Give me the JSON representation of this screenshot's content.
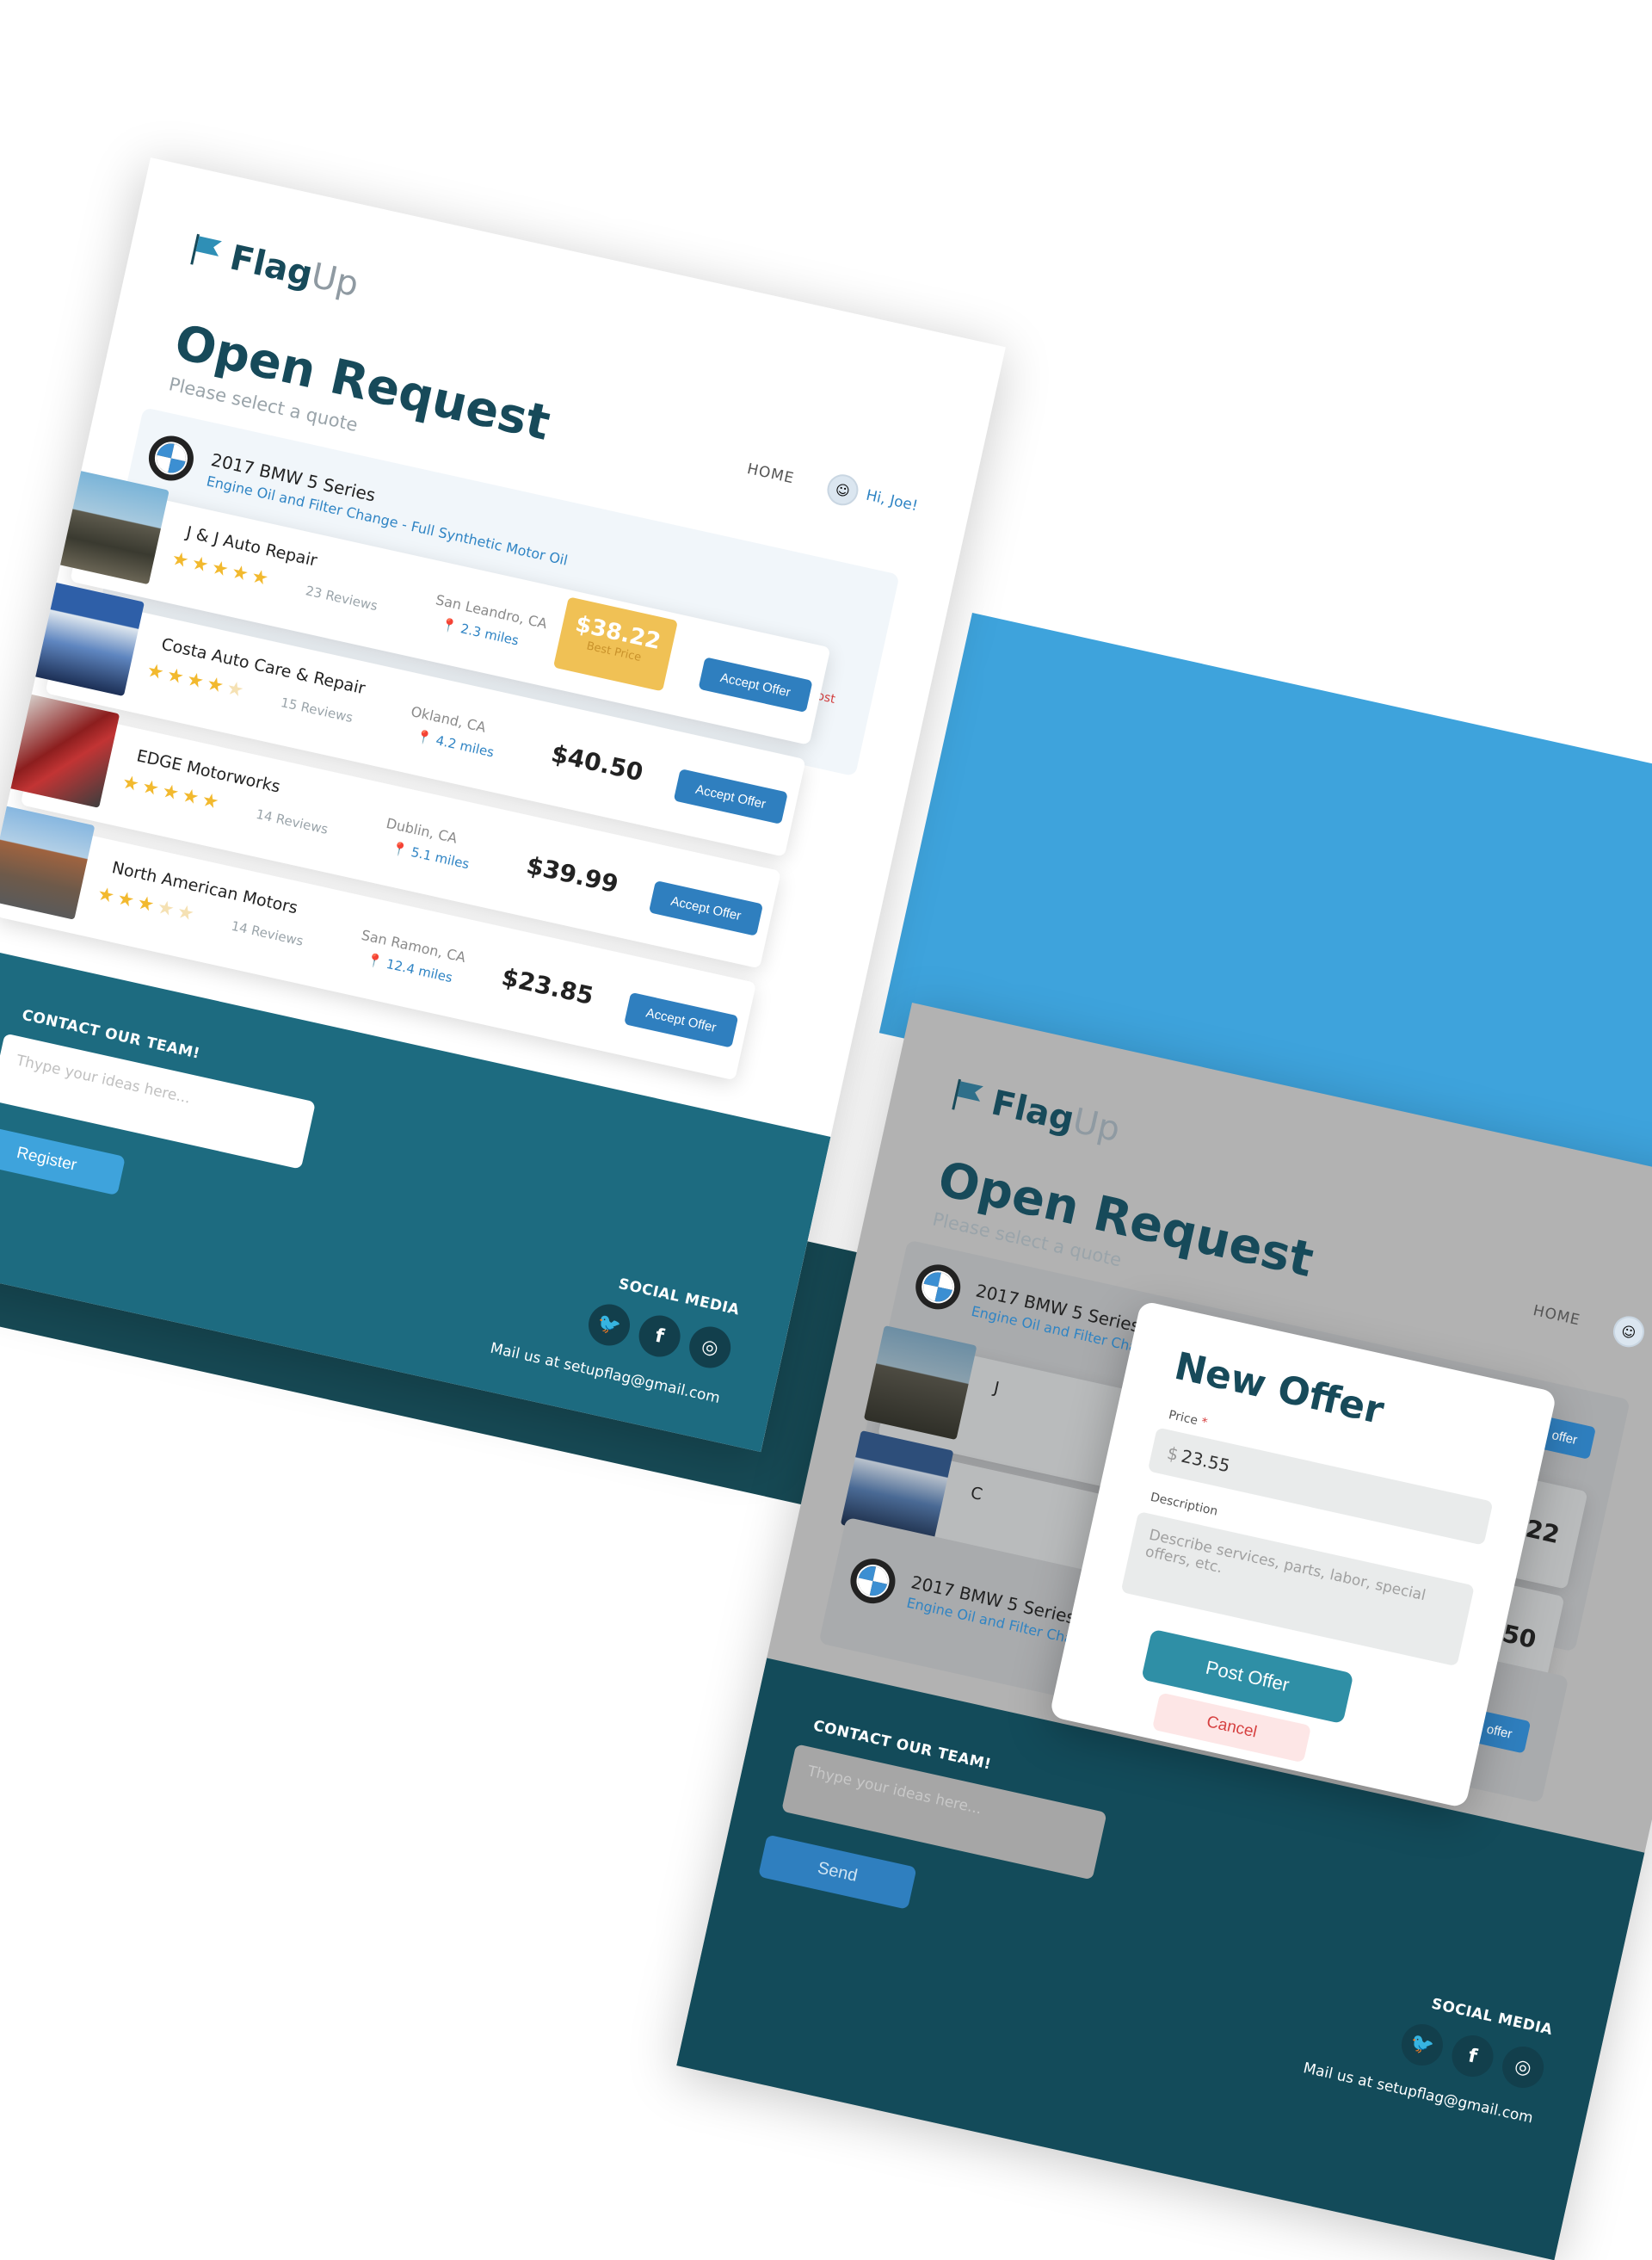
{
  "brand": {
    "name_main": "Flag",
    "name_accent": "Up"
  },
  "nav": {
    "home": "HOME",
    "greeting": "Hi, Joe!"
  },
  "page": {
    "title": "Open Request",
    "subtitle": "Please select a quote"
  },
  "request": {
    "car": "2017 BMW 5 Series",
    "service": "Engine Oil and Filter Change - Full Synthetic Motor Oil",
    "delete_label": "Delete Post",
    "delete_icon": "trash-icon"
  },
  "shops": [
    {
      "name": "J & J Auto Repair",
      "stars": 5,
      "reviews": "23 Reviews",
      "city": "San Leandro, CA",
      "distance": "2.3 miles",
      "price": "$38.22",
      "best_label": "Best Price",
      "is_best": true,
      "action": "Accept Offer"
    },
    {
      "name": "Costa Auto Care & Repair",
      "stars": 4,
      "reviews": "15 Reviews",
      "city": "Okland, CA",
      "distance": "4.2 miles",
      "price": "$40.50",
      "is_best": false,
      "action": "Accept Offer"
    },
    {
      "name": "EDGE Motorworks",
      "stars": 5,
      "reviews": "14 Reviews",
      "city": "Dublin, CA",
      "distance": "5.1 miles",
      "price": "$39.99",
      "is_best": false,
      "action": "Accept Offer"
    },
    {
      "name": "North American Motors",
      "stars": 3,
      "reviews": "14 Reviews",
      "city": "San Ramon, CA",
      "distance": "12.4 miles",
      "price": "$23.85",
      "is_best": false,
      "action": "Accept Offer"
    }
  ],
  "footer": {
    "contact_title": "CONTACT OUR TEAM!",
    "idea_placeholder": "Thype your ideas here...",
    "register_label": "Register",
    "send_label": "Send",
    "social_title": "SOCIAL MEDIA",
    "social_icons": [
      "twitter-icon",
      "facebook-icon",
      "instagram-icon"
    ],
    "mail": "Mail us at setupflag@gmail.com"
  },
  "modal": {
    "title": "New Offer",
    "price_label": "Price",
    "required_mark": "*",
    "currency": "$",
    "price_value": "23.55",
    "description_label": "Description",
    "description_placeholder": "Describe services, parts, labor, special offers, etc.",
    "post_label": "Post Offer",
    "cancel_label": "Cancel"
  },
  "right_panel": {
    "make_offer_label": "Make an offer",
    "price_1": "$38.22",
    "price_2": "$40.50",
    "partial_1": "J",
    "partial_2": "C"
  },
  "colors": {
    "brand_dark": "#174a5a",
    "accent_blue": "#3ea3dc",
    "button_blue": "#2f7fbf",
    "footer_teal": "#1d6b80",
    "footer_dark": "#174a55",
    "best_price": "#f0c155",
    "danger": "#d64040"
  }
}
